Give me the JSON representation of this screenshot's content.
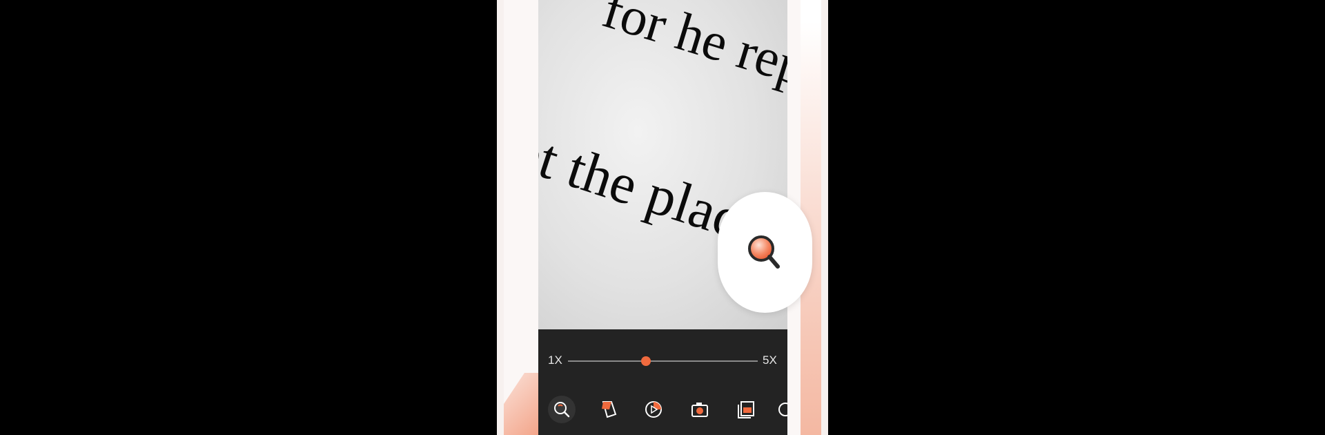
{
  "zoom": {
    "min_label": "1X",
    "max_label": "5X",
    "level_fraction": 0.41
  },
  "camera_preview": {
    "line1": "for he repli",
    "line2": "ot the plac"
  },
  "toolbar": {
    "tools": [
      {
        "icon": "magnifier-icon",
        "active": true
      },
      {
        "icon": "highlighter-icon",
        "active": false
      },
      {
        "icon": "play-icon",
        "active": false
      },
      {
        "icon": "camera-icon",
        "active": false
      },
      {
        "icon": "gallery-icon",
        "active": false
      },
      {
        "icon": "more-icon",
        "active": false
      }
    ]
  },
  "floating_button": {
    "icon": "magnifier-icon"
  },
  "colors": {
    "accent": "#f06a3e",
    "panel": "#232323",
    "background": "#000000"
  }
}
